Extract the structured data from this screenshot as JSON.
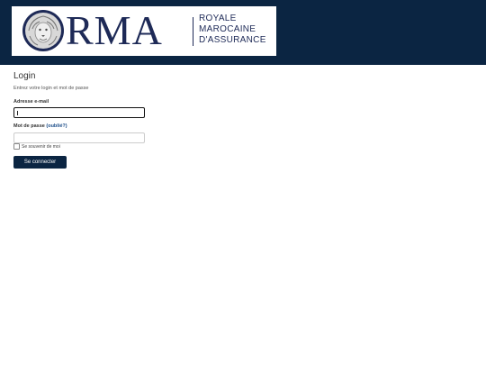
{
  "brand": {
    "logo_text": "RMA",
    "tagline": [
      "ROYALE",
      "MAROCAINE",
      "D'ASSURANCE"
    ],
    "header_color": "#0b2542",
    "logo_color": "#1e2a57"
  },
  "login": {
    "title": "Login",
    "subtitle": "Entrez votre login et mot de passe",
    "email_label": "Adresse e-mail",
    "email_value": "",
    "password_label": "Mot de passe",
    "forgot_link": "(oublié?)",
    "password_value": "",
    "remember_label": "Se souvenir de moi",
    "remember_checked": false,
    "submit_label": "Se connecter"
  }
}
